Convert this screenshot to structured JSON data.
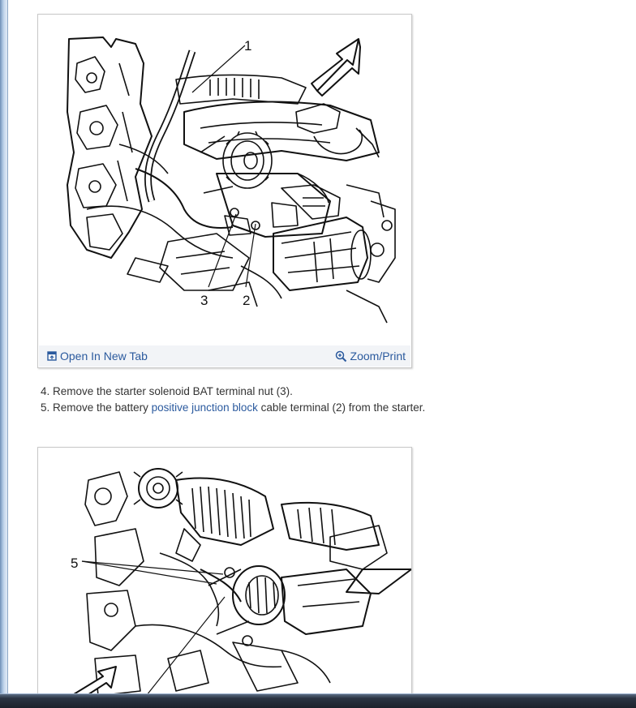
{
  "figure1": {
    "callouts": [
      "1",
      "2",
      "3"
    ],
    "toolbar": {
      "open_new_tab_label": "Open In New Tab",
      "zoom_print_label": "Zoom/Print"
    }
  },
  "steps": [
    {
      "number": "4.",
      "text": "Remove the starter solenoid BAT terminal nut (3)."
    },
    {
      "number": "5.",
      "text_before": "Remove the battery ",
      "link_text": "positive junction block",
      "text_after": " cable terminal (2) from the starter."
    }
  ],
  "figure2": {
    "callouts": [
      "5"
    ]
  },
  "colors": {
    "link": "#2b5a9e",
    "toolbar_bg": "#f2f4f7",
    "window_frame": "#a9c3e0"
  }
}
